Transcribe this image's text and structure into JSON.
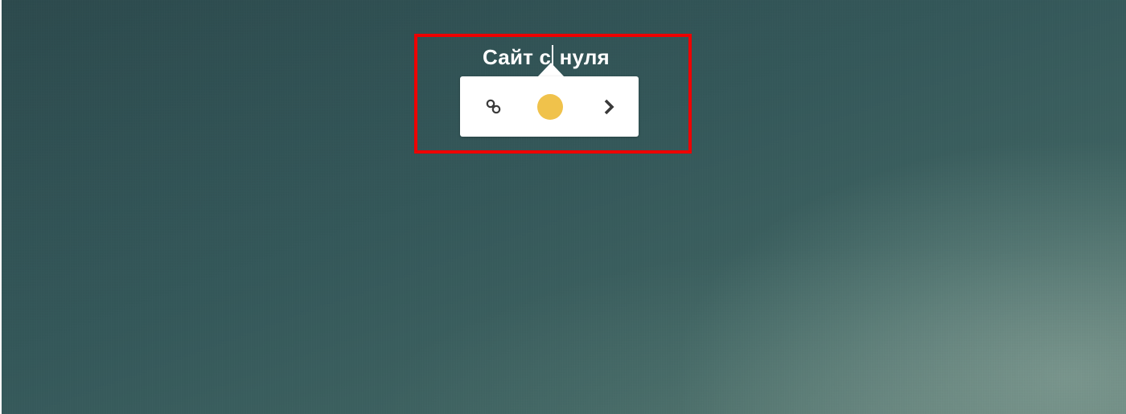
{
  "editor": {
    "title_before_caret": "Сайт с",
    "title_after_caret": "нуля"
  },
  "toolbar": {
    "items": [
      {
        "name": "link-icon",
        "glyph": "link"
      },
      {
        "name": "color-swatch",
        "color": "#f0c24b"
      },
      {
        "name": "chevron-right-icon",
        "glyph": "chevron-right"
      }
    ]
  },
  "colors": {
    "highlight_border": "#ee0000",
    "swatch": "#f0c24b",
    "icon": "#3a3a3a"
  }
}
